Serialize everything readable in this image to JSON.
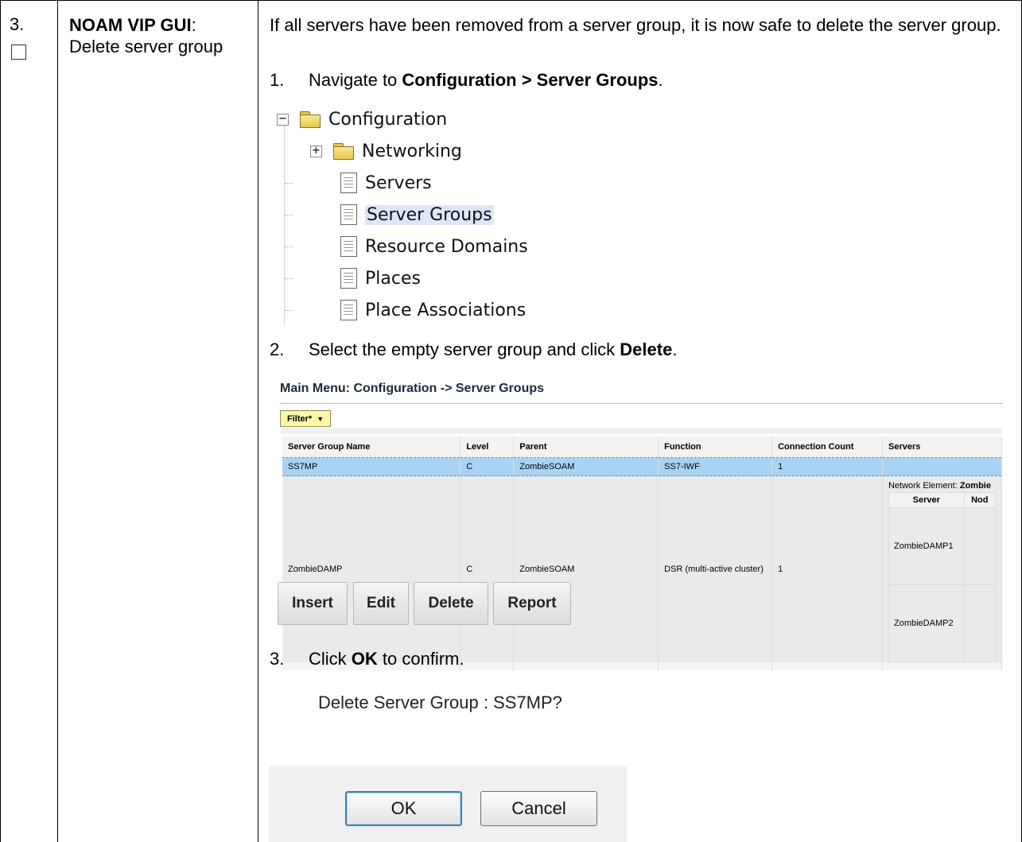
{
  "step": {
    "number": "3.",
    "title_bold": "NOAM VIP GUI",
    "title_colon": ":",
    "title_rest": "Delete server group"
  },
  "intro": "If all servers have been removed from a server group, it is now safe to delete the server group.",
  "substeps": [
    {
      "num": "1.",
      "pre": "Navigate to ",
      "bold": "Configuration > Server Groups",
      "post": "."
    },
    {
      "num": "2.",
      "pre": "Select the empty server group and click ",
      "bold": "Delete",
      "post": "."
    },
    {
      "num": "3.",
      "pre": "Click ",
      "bold": "OK",
      "post": " to confirm."
    }
  ],
  "tree": {
    "root": "Configuration",
    "items": [
      "Networking",
      "Servers",
      "Server Groups",
      "Resource Domains",
      "Places",
      "Place Associations"
    ],
    "selected": "Server Groups"
  },
  "server_groups": {
    "title": "Main Menu: Configuration -> Server Groups",
    "filter_label": "Filter*",
    "columns": [
      "Server Group Name",
      "Level",
      "Parent",
      "Function",
      "Connection Count",
      "Servers"
    ],
    "rows": [
      {
        "name": "SS7MP",
        "level": "C",
        "parent": "ZombieSOAM",
        "function": "SS7-IWF",
        "count": "1"
      },
      {
        "name": "ZombieDAMP",
        "level": "C",
        "parent": "ZombieSOAM",
        "function": "DSR (multi-active cluster)",
        "count": "1"
      }
    ],
    "network_element_label": "Network Element: ",
    "network_element_value": "Zombie",
    "nested_headers": [
      "Server",
      "Nod"
    ],
    "nested_servers": [
      "ZombieDAMP1",
      "ZombieDAMP2"
    ]
  },
  "buttons": {
    "insert": "Insert",
    "edit": "Edit",
    "delete": "Delete",
    "report": "Report"
  },
  "confirm": {
    "message": "Delete Server Group : SS7MP?",
    "ok": "OK",
    "cancel": "Cancel"
  }
}
